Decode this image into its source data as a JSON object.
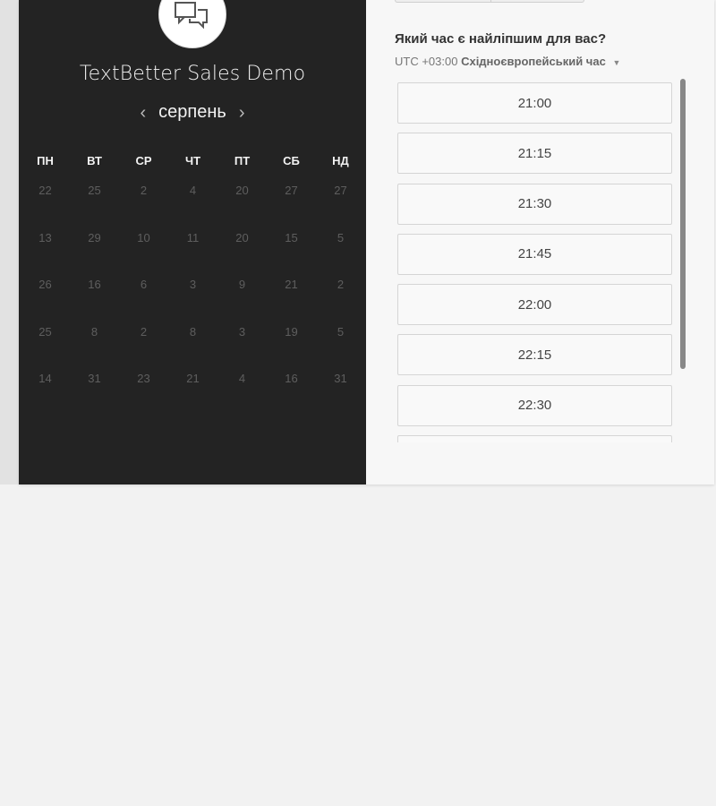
{
  "company_name": "TextBetter Sales Demo",
  "calendar": {
    "month": "серпень",
    "prev_label": "‹",
    "next_label": "›",
    "weekdays": [
      "ПН",
      "ВТ",
      "СР",
      "ЧТ",
      "ПТ",
      "СБ",
      "НД"
    ],
    "weeks": [
      [
        "22",
        "25",
        "2",
        "4",
        "20",
        "27",
        "27"
      ],
      [
        "13",
        "29",
        "10",
        "11",
        "20",
        "15",
        "5"
      ],
      [
        "26",
        "16",
        "6",
        "3",
        "9",
        "21",
        "2"
      ],
      [
        "25",
        "8",
        "2",
        "8",
        "3",
        "19",
        "5"
      ],
      [
        "14",
        "31",
        "23",
        "21",
        "4",
        "16",
        "31"
      ]
    ]
  },
  "schedule": {
    "question": "Який час є найліпшим для вас?",
    "timezone_offset": "UTC +03:00",
    "timezone_name": "Східноєвропейський час",
    "slots": [
      "21:00",
      "21:15",
      "21:30",
      "21:45",
      "22:00",
      "22:15",
      "22:30",
      ""
    ]
  },
  "colors": {
    "panel_dark": "#232323",
    "panel_light": "#f7f7f7",
    "page_background": "#f2f2f2"
  },
  "icons": {
    "logo": "chat-bubbles-icon",
    "timezone_dropdown": "caret-down-icon",
    "prev_month": "chevron-left-icon",
    "next_month": "chevron-right-icon"
  }
}
